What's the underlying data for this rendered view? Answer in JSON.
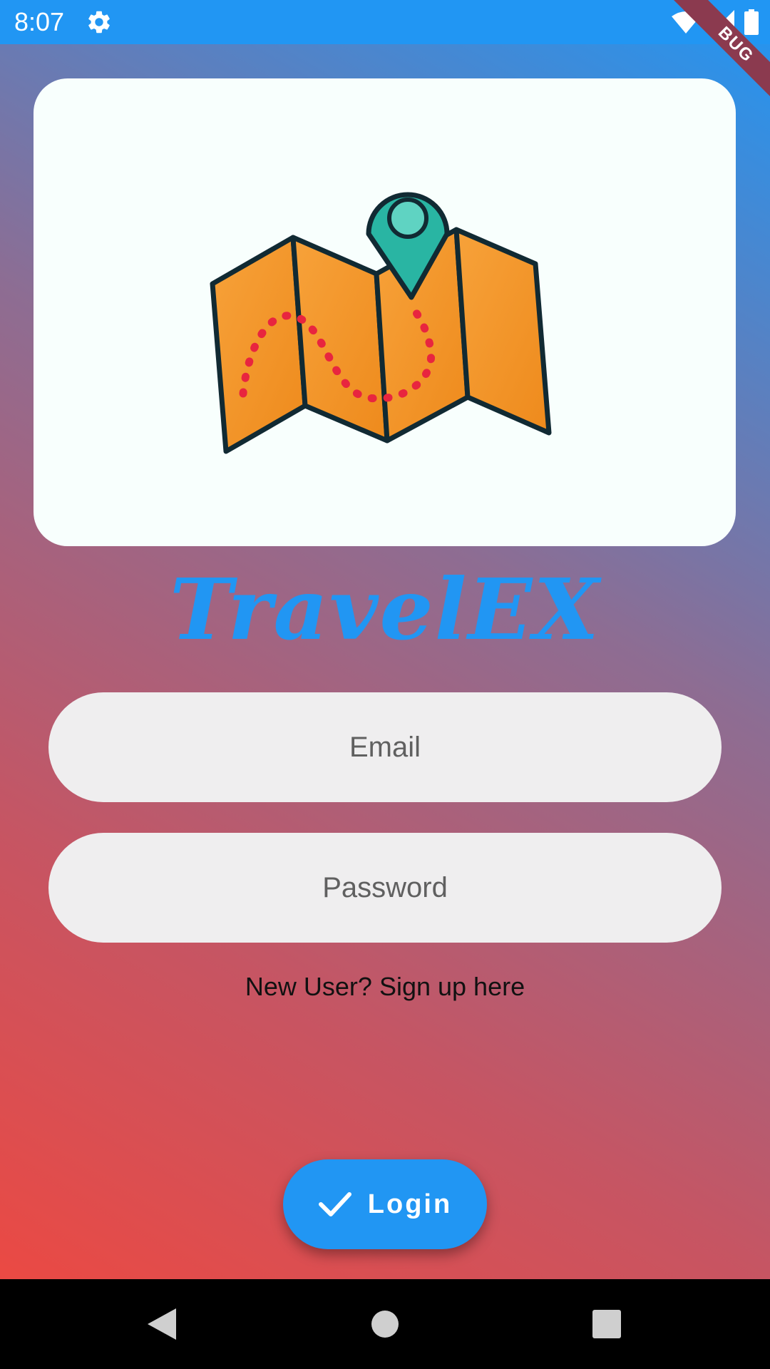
{
  "status_bar": {
    "time": "8:07",
    "icons": [
      "gear-icon",
      "wifi-icon",
      "signal-icon",
      "battery-icon"
    ],
    "background": "#2196f3"
  },
  "debug_ribbon": {
    "label": "BUG"
  },
  "hero": {
    "image": "folded-map-with-location-pin illustration"
  },
  "app_title": "TravelEX",
  "form": {
    "email_placeholder": "Email",
    "password_placeholder": "Password",
    "signup_text": "New User? Sign up here"
  },
  "login_button": {
    "label": "Login",
    "icon": "check-icon",
    "color": "#2196f3"
  },
  "nav": {
    "buttons": [
      "back-icon",
      "home-icon",
      "recents-icon"
    ]
  },
  "colors": {
    "gradient_start": "#f2473d",
    "gradient_end": "#2196f3",
    "field_bg": "#efeeef"
  }
}
